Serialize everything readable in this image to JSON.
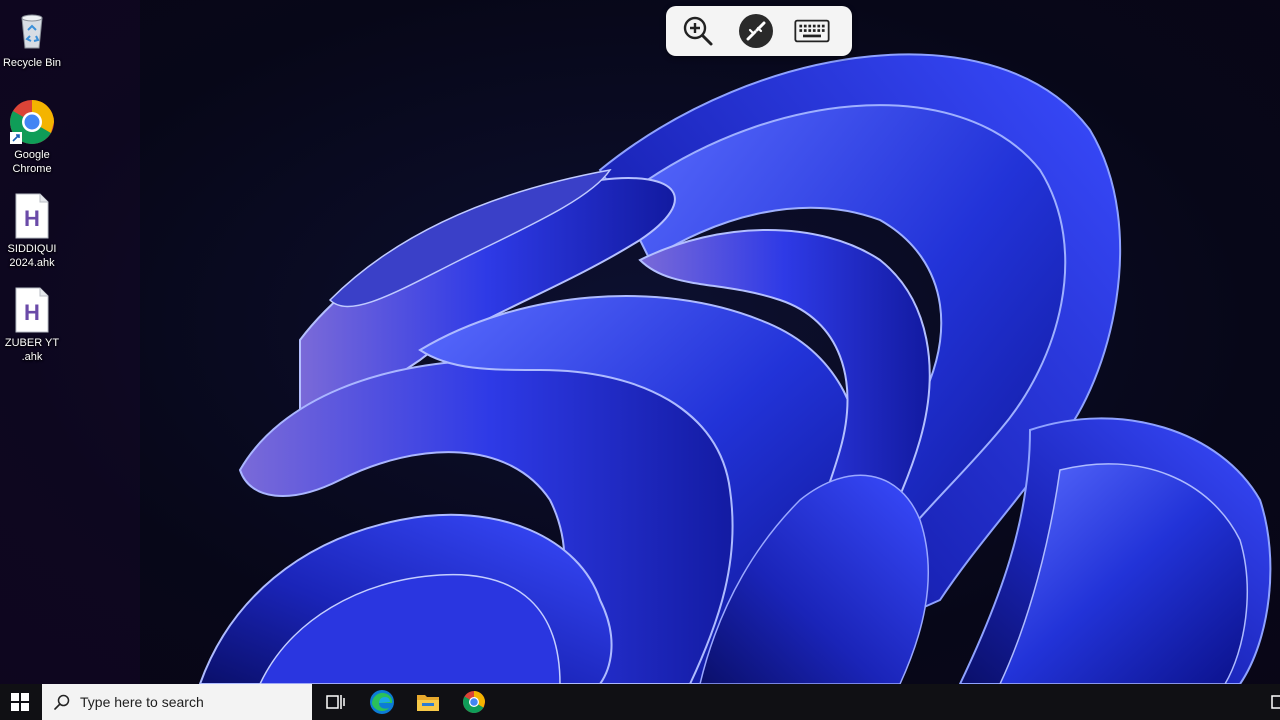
{
  "desktop": {
    "icons": [
      {
        "label": "Recycle Bin",
        "icon": "recycle-bin-icon"
      },
      {
        "label": "Google\nChrome",
        "icon": "chrome-icon"
      },
      {
        "label": "SIDDIQUI\n2024.ahk",
        "icon": "ahk-file-icon"
      },
      {
        "label": "ZUBER YT\n.ahk",
        "icon": "ahk-file-icon"
      }
    ],
    "wallpaper": "windows-11-bloom-blue"
  },
  "rdp_toolbar": {
    "buttons": [
      {
        "icon": "zoom-in-icon"
      },
      {
        "icon": "remote-disconnect-icon"
      },
      {
        "icon": "keyboard-icon"
      }
    ]
  },
  "taskbar": {
    "start_icon": "windows-logo-icon",
    "search": {
      "placeholder": "Type here to search",
      "icon": "search-icon"
    },
    "pinned": [
      {
        "icon": "task-view-icon"
      },
      {
        "icon": "edge-icon"
      },
      {
        "icon": "file-explorer-icon"
      },
      {
        "icon": "chrome-icon"
      }
    ]
  },
  "colors": {
    "taskbar": "#101014",
    "search_box": "#f3f3f3",
    "accent_blue": "#2b3de8"
  }
}
